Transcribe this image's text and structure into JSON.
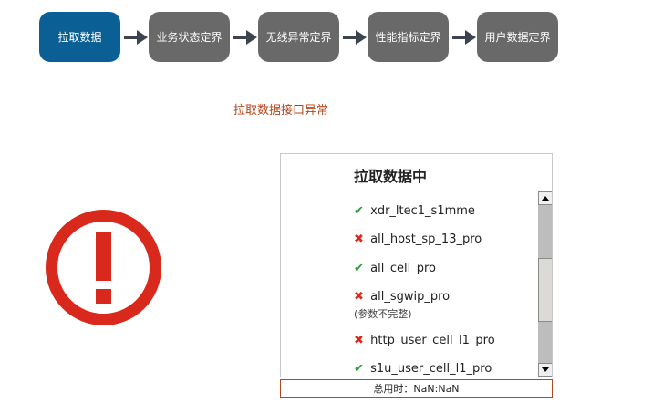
{
  "steps": [
    {
      "label": "拉取数据"
    },
    {
      "label": "业务状态定界"
    },
    {
      "label": "无线异常定界"
    },
    {
      "label": "性能指标定界"
    },
    {
      "label": "用户数据定界"
    }
  ],
  "error_message": "拉取数据接口异常",
  "panel": {
    "title": "拉取数据中",
    "items": [
      {
        "name": "xdr_ltec1_s1mme",
        "status": "ok",
        "mark": "✔"
      },
      {
        "name": "all_host_sp_13_pro",
        "status": "error",
        "mark": "✖"
      },
      {
        "name": "all_cell_pro",
        "status": "ok",
        "mark": "✔"
      },
      {
        "name": "all_sgwip_pro",
        "status": "error",
        "mark": "✖",
        "note": "(参数不完整)"
      },
      {
        "name": "http_user_cell_l1_pro",
        "status": "error",
        "mark": "✖"
      },
      {
        "name": "s1u_user_cell_l1_pro",
        "status": "ok",
        "mark": "✔"
      }
    ]
  },
  "total_time": "总用时：NaN:NaN",
  "colors": {
    "active_step": "#0a5f95",
    "inactive_step": "#696969",
    "error_red": "#d9291c",
    "ok_green": "#2e9a3a",
    "error_text": "#b5471c"
  },
  "icons": {
    "big": "exclamation-circle-icon",
    "arrow": "right-arrow-icon"
  }
}
